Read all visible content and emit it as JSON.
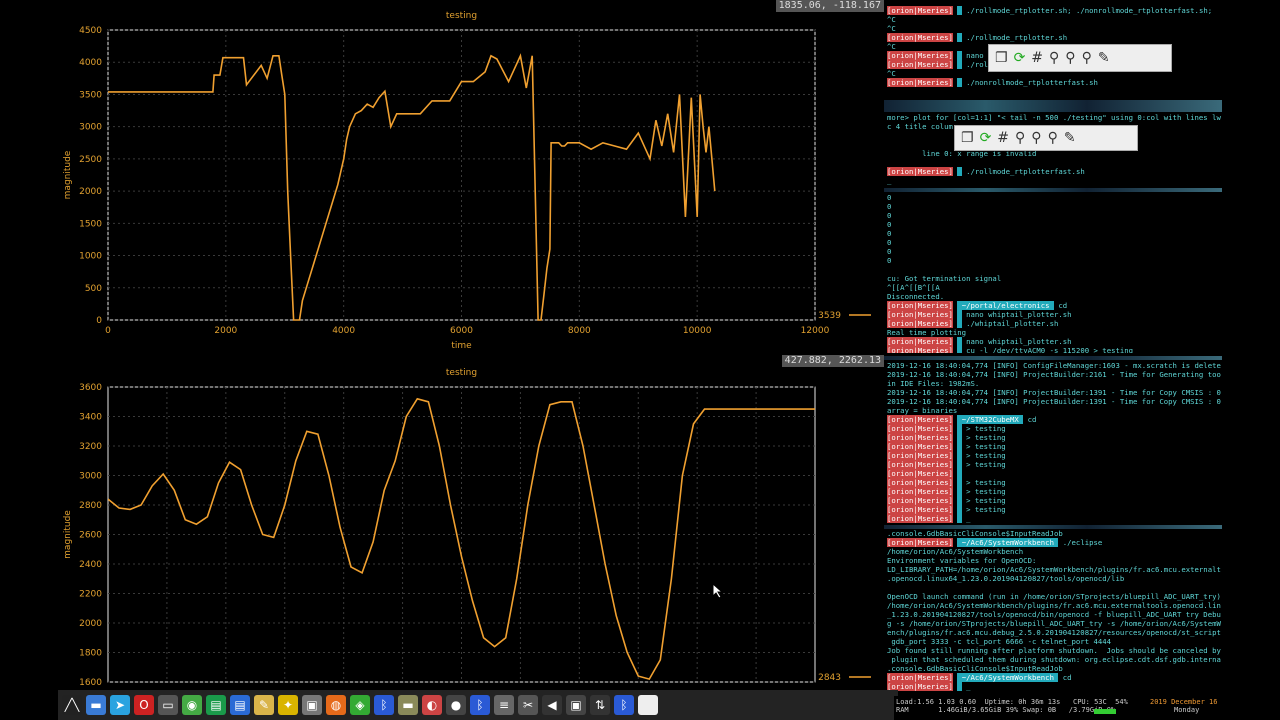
{
  "colors": {
    "trace": "#f0a030",
    "axis_text": "#e0a030",
    "grid": "#3a3a3a",
    "border": "#e8e8e8",
    "term_text": "#5fd7d7",
    "prompt_user_bg": "#cc4444",
    "prompt_path_bg": "#22aabb"
  },
  "plot_top": {
    "coord": "1835.06, -118.167",
    "title": "testing",
    "xlabel": "time",
    "ylabel": "magnitude",
    "legend_value": "3539"
  },
  "plot_bottom": {
    "coord": "427.882, 2262.13",
    "title": "testing",
    "ylabel": "magnitude",
    "legend_value": "2843"
  },
  "chart_data": [
    {
      "type": "line",
      "title": "testing",
      "xlabel": "time",
      "ylabel": "magnitude",
      "xlim": [
        0,
        12000
      ],
      "ylim": [
        0,
        4500
      ],
      "xticks": [
        "0",
        "2000",
        "4000",
        "6000",
        "8000",
        "10000",
        "12000"
      ],
      "yticks": [
        "0",
        "500",
        "1000",
        "1500",
        "2000",
        "2500",
        "3000",
        "3500",
        "4000",
        "4500"
      ],
      "grid": true,
      "legend": "right",
      "series": [
        {
          "values_x": [
            0,
            1780,
            1800,
            1900,
            1950,
            2300,
            2350,
            2600,
            2700,
            2800,
            2900,
            2950,
            3000,
            3050,
            3100,
            3150,
            3200,
            3250,
            3300,
            3400,
            3500,
            3600,
            3700,
            3800,
            3900,
            4000,
            4050,
            4100,
            4200,
            4300,
            4400,
            4500,
            4600,
            4700,
            4800,
            4900,
            5000,
            5100,
            5300,
            5500,
            5800,
            6000,
            6200,
            6400,
            6500,
            6600,
            6800,
            7000,
            7100,
            7200,
            7300,
            7350,
            7400,
            7450,
            7500,
            7520,
            7560,
            7600,
            7650,
            7700,
            7750,
            7800,
            7900,
            8000,
            8200,
            8400,
            8600,
            8800,
            9000,
            9200,
            9300,
            9400,
            9500,
            9600,
            9700,
            9800,
            9900,
            10000,
            10050,
            10100,
            10150,
            10200,
            10250,
            10300
          ],
          "values_y": [
            3540,
            3540,
            3800,
            3800,
            4070,
            4070,
            3650,
            3950,
            3750,
            4100,
            4100,
            3800,
            3500,
            2000,
            1000,
            0,
            0,
            0,
            300,
            600,
            900,
            1200,
            1500,
            1800,
            2100,
            2500,
            2800,
            3000,
            3200,
            3250,
            3350,
            3300,
            3450,
            3550,
            3000,
            3200,
            3200,
            3200,
            3200,
            3400,
            3400,
            3700,
            3700,
            3850,
            4100,
            4050,
            3700,
            4100,
            3600,
            4100,
            0,
            0,
            400,
            800,
            1100,
            2750,
            2750,
            2750,
            2750,
            2700,
            2700,
            2750,
            2750,
            2750,
            2650,
            2750,
            2700,
            2650,
            2900,
            2500,
            3100,
            2700,
            3200,
            2600,
            3500,
            1600,
            3450,
            1600,
            3500,
            3000,
            2600,
            3000,
            2500,
            2000
          ]
        }
      ]
    },
    {
      "type": "line",
      "title": "testing",
      "ylabel": "magnitude",
      "ylim": [
        1600,
        3600
      ],
      "yticks": [
        "1600",
        "1800",
        "2000",
        "2200",
        "2400",
        "2600",
        "2800",
        "3000",
        "3200",
        "3400",
        "3600"
      ],
      "grid": true,
      "legend": "right",
      "series": [
        {
          "values_x": [
            0,
            4,
            8,
            12,
            16,
            20,
            24,
            28,
            32,
            36,
            40,
            44,
            48,
            52,
            56,
            60,
            64,
            68,
            72,
            76,
            80,
            84,
            88,
            92,
            96,
            100,
            104,
            108,
            112,
            116,
            120,
            124,
            128,
            132,
            136,
            140,
            144,
            148,
            152,
            156,
            160,
            164,
            168,
            172,
            176,
            180,
            184,
            188,
            192,
            196,
            200,
            204,
            208,
            212,
            216,
            220,
            224,
            228,
            232,
            236,
            240,
            244,
            248,
            252,
            256,
            260,
            264,
            268,
            272,
            276,
            280,
            284,
            288,
            292,
            296,
            300
          ],
          "values_y": [
            2840,
            2780,
            2770,
            2800,
            2930,
            3010,
            2900,
            2700,
            2670,
            2720,
            2950,
            3090,
            3040,
            2800,
            2600,
            2580,
            2800,
            3100,
            3300,
            3280,
            3000,
            2650,
            2380,
            2340,
            2550,
            2900,
            3100,
            3400,
            3520,
            3500,
            3200,
            2800,
            2450,
            2150,
            1900,
            1840,
            1900,
            2300,
            2800,
            3200,
            3480,
            3500,
            3500,
            3200,
            2800,
            2400,
            2050,
            1800,
            1640,
            1620,
            1750,
            2300,
            3000,
            3350,
            3450,
            3450,
            3450,
            3450,
            3450,
            3450,
            3450,
            3450,
            3450,
            3450,
            3450,
            3450,
            3450,
            3450,
            3450,
            3450,
            3450,
            3450,
            3450,
            3450,
            3450,
            3450
          ]
        }
      ]
    }
  ],
  "terminal": {
    "pane1": [
      {
        "user": "[orion|Mseries]",
        "cmd": " ./rollmode_rtplotter.sh; ./nonrollmode_rtplotterfast.sh;"
      },
      {
        "text": "^C"
      },
      {
        "text": "^C"
      },
      {
        "user": "[orion|Mseries]",
        "cmd": " ./rollmode_rtplotter.sh"
      },
      {
        "text": "^C"
      },
      {
        "user": "[orion|Mseries]",
        "cmd": " nano ro"
      },
      {
        "user": "[orion|Mseries]",
        "cmd": " ./roll"
      },
      {
        "text": "^C"
      },
      {
        "user": "[orion|Mseries]",
        "cmd": " ./nonrollmode_rtplotterfast.sh"
      }
    ],
    "pane2": [
      {
        "text": "more> plot for [col=1:1] \"< tail -n 500 ./testing\" using 0:col with lines lw 2 l"
      },
      {
        "text": "c 4 title colum"
      },
      {
        "text": ""
      },
      {
        "text": ""
      },
      {
        "text": "        line 0: x range is invalid"
      },
      {
        "text": ""
      },
      {
        "user": "[orion|Mseries]",
        "cmd": " ./rollmode_rtplotterfast.sh"
      },
      {
        "text": "_"
      }
    ],
    "pane3": [
      {
        "text": "0"
      },
      {
        "text": "0"
      },
      {
        "text": "0"
      },
      {
        "text": "0"
      },
      {
        "text": "0"
      },
      {
        "text": "0"
      },
      {
        "text": "0"
      },
      {
        "text": "0"
      },
      {
        "text": ""
      },
      {
        "text": "cu: Got termination signal"
      },
      {
        "text": "^[[A^[[B^[[A"
      },
      {
        "text": "Disconnected."
      },
      {
        "user": "[orion|Mseries]",
        "path": " ~/portal/electronics ",
        "cmd": " cd"
      },
      {
        "user": "[orion|Mseries]",
        "cmd": " nano whiptail_plotter.sh"
      },
      {
        "user": "[orion|Mseries]",
        "cmd": " ./whiptail_plotter.sh"
      },
      {
        "text": "Real time plotting"
      },
      {
        "user": "[orion|Mseries]",
        "cmd": " nano whiptail_plotter.sh"
      },
      {
        "user": "[orion|Mseries]",
        "cmd": " cu -l /dev/ttyACM0 -s 115200 > testing"
      }
    ],
    "pane4": [
      {
        "text": "2019-12-16 18:40:04,774 [INFO] ConfigFileManager:1603 - mx.scratch is deleted!"
      },
      {
        "text": "2019-12-16 18:40:04,774 [INFO] ProjectBuilder:2161 - Time for Generating toolcha"
      },
      {
        "text": "in IDE Files: 1982mS."
      },
      {
        "text": "2019-12-16 18:40:04,774 [INFO] ProjectBuilder:1391 - Time for Copy CMSIS : 0mS."
      },
      {
        "text": "2019-12-16 18:40:04,774 [INFO] ProjectBuilder:1391 - Time for Copy CMSIS : 0mS."
      },
      {
        "text": "array = binaries"
      },
      {
        "user": "[orion|Mseries]",
        "path": " ~/STM32CubeMX ",
        "cmd": " cd"
      },
      {
        "user": "[orion|Mseries]",
        "cmd": " > testing"
      },
      {
        "user": "[orion|Mseries]",
        "cmd": " > testing"
      },
      {
        "user": "[orion|Mseries]",
        "cmd": " > testing"
      },
      {
        "user": "[orion|Mseries]",
        "cmd": " > testing"
      },
      {
        "user": "[orion|Mseries]",
        "cmd": " > testing"
      },
      {
        "user": "[orion|Mseries]",
        "cmd": ""
      },
      {
        "user": "[orion|Mseries]",
        "cmd": " > testing"
      },
      {
        "user": "[orion|Mseries]",
        "cmd": " > testing"
      },
      {
        "user": "[orion|Mseries]",
        "cmd": " > testing"
      },
      {
        "user": "[orion|Mseries]",
        "cmd": " > testing"
      },
      {
        "user": "[orion|Mseries]",
        "cmd": " _"
      }
    ],
    "pane5": [
      {
        "text": ".console.GdbBasicCliConsole$InputReadJob"
      },
      {
        "user": "[orion|Mseries]",
        "path": " ~/Ac6/SystemWorkbench ",
        "cmd": " ./eclipse"
      },
      {
        "text": "/home/orion/Ac6/SystemWorkbench"
      },
      {
        "text": "Environment variables for OpenOCD:"
      },
      {
        "text": "LD_LIBRARY_PATH=/home/orion/Ac6/SystemWorkbench/plugins/fr.ac6.mcu.externaltools"
      },
      {
        "text": ".openocd.linux64_1.23.0.201904120827/tools/openocd/lib"
      },
      {
        "text": ""
      },
      {
        "text": "OpenOCD launch command (run in /home/orion/STprojects/bluepill_ADC_UART_try):"
      },
      {
        "text": "/home/orion/Ac6/SystemWorkbench/plugins/fr.ac6.mcu.externaltools.openocd.linux64"
      },
      {
        "text": "_1.23.0.201904120827/tools/openocd/bin/openocd -f bluepill_ADC_UART try Debug.cf"
      },
      {
        "text": "g -s /home/orion/STprojects/bluepill_ADC_UART_try -s /home/orion/Ac6/SystemWorkb"
      },
      {
        "text": "ench/plugins/fr.ac6.mcu.debug_2.5.0.201904120827/resources/openocd/st_scripts -c"
      },
      {
        "text": " gdb_port 3333 -c tcl_port 6666 -c telnet_port 4444"
      },
      {
        "text": "Job found still running after platform shutdown.  Jobs should be canceled by the"
      },
      {
        "text": " plugin that scheduled them during shutdown: org.eclipse.cdt.dsf.gdb.internal.ui"
      },
      {
        "text": ".console.GdbBasicCliConsole$InputReadJob"
      },
      {
        "user": "[orion|Mseries]",
        "path": " ~/Ac6/SystemWorkbench ",
        "cmd": " cd"
      },
      {
        "user": "[orion|Mseries]",
        "cmd": " _"
      }
    ]
  },
  "sysbar": {
    "line1": "Load:1.56 1.03 0.60  Uptime: 0h 36m 13s   CPU: 53C  54%",
    "line2": "RAM       1.46GiB/3.65GiB 39% Swap: 0B   /3.79GiB 0%",
    "date": "2019 December 16",
    "day": "Monday"
  },
  "taskbar": {
    "icons": [
      "menu-icon",
      "files-icon",
      "telegram-icon",
      "opera-icon",
      "display-icon",
      "chrome-icon",
      "sheets-icon",
      "docs-icon",
      "draw-icon",
      "ticket-icon",
      "suitcase-icon",
      "firefox-icon",
      "nautilus-icon",
      "bluetooth-icon",
      "folder-icon",
      "paint-icon",
      "disc-icon",
      "bluetooth-icon-2",
      "lines-icon",
      "tools-icon",
      "volume-icon",
      "camera-icon",
      "network-icon",
      "bluetooth-icon-3",
      "blank-icon"
    ]
  }
}
